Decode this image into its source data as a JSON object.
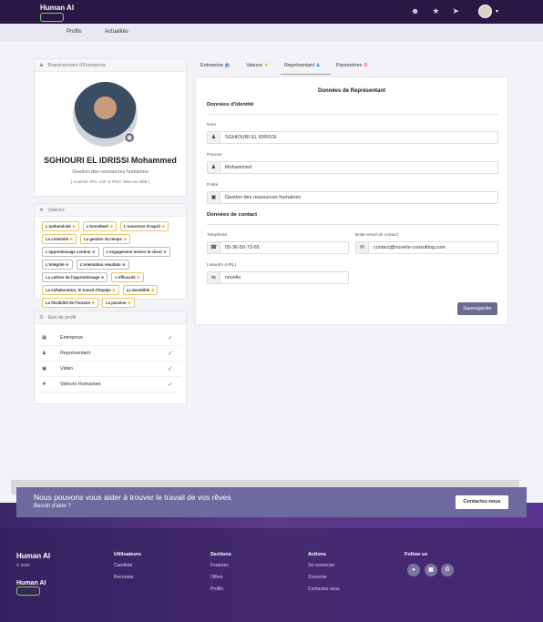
{
  "header": {
    "logo_text": "Human AI",
    "icons": [
      "add-user-icon",
      "star-icon",
      "send-icon"
    ]
  },
  "subnav": {
    "items": [
      "Profils",
      "Actualités"
    ]
  },
  "left_card": {
    "title": "Représentant d'Entreprise",
    "name": "SGHIOURI EL IDRISSI Mohammed",
    "role": "Gestion des ressources humaines",
    "note": "( Autorisé JPG, GIF or PNG. Max est 3MB )"
  },
  "values_card": {
    "title": "Valeurs",
    "tags": [
      {
        "label": "L'authenticité",
        "style": "gold"
      },
      {
        "label": "L'honnêteté",
        "style": "gold"
      },
      {
        "label": "L'ouverture d'esprit",
        "style": "gold"
      },
      {
        "label": "La créativité",
        "style": "gold"
      },
      {
        "label": "La gestion du temps",
        "style": "gold"
      },
      {
        "label": "L'apprentissage continu",
        "style": "grey"
      },
      {
        "label": "L'engagement envers le client",
        "style": "grey"
      },
      {
        "label": "L'intégrité",
        "style": "grey"
      },
      {
        "label": "L'orientation résultats",
        "style": "grey"
      },
      {
        "label": "La culture de l'apprentissage",
        "style": "grey"
      },
      {
        "label": "L'efficacité",
        "style": "gold"
      },
      {
        "label": "La collaboration, le travail d'équipe",
        "style": "gold"
      },
      {
        "label": "La durabilité",
        "style": "gold"
      },
      {
        "label": "La flexibilité de l'horaire",
        "style": "gold"
      },
      {
        "label": "La passion",
        "style": "gold"
      }
    ]
  },
  "state_card": {
    "title": "Etat de profil",
    "rows": [
      {
        "icon": "building-icon",
        "label": "Entreprise"
      },
      {
        "icon": "person-icon",
        "label": "Représentant"
      },
      {
        "icon": "video-icon",
        "label": "Vidéo"
      },
      {
        "icon": "star-icon",
        "label": "Valeurs Humaines"
      }
    ]
  },
  "tabs": [
    "Entreprise",
    "Valeurs",
    "Représentant",
    "Paramètres"
  ],
  "form": {
    "title": "Données de Représentant",
    "identity_title": "Données d'identité",
    "nom_label": "Nom",
    "nom_value": "SGHIOURI EL IDRISSI",
    "prenom_label": "Prenom",
    "prenom_value": "Mohammed",
    "poste_label": "Poste",
    "poste_value": "Gestion des ressources humaines",
    "contact_title": "Données de contact",
    "tel_label": "Telephone",
    "tel_value": "05-36-50-73-65",
    "email_label": "Boite email de contact",
    "email_value": "contact@novelis-consulting.com",
    "linkedin_label": "LinkedIn (URL)",
    "linkedin_value": "novelis",
    "save_label": "Sauvegarder"
  },
  "banner": {
    "headline": "Nous pouvons vous aider à trouver le travail de vos rêves.",
    "sub": "Besoin d'aide ?",
    "button": "Contactez-nous"
  },
  "footer": {
    "brand": "Human AI",
    "copyright": "© 2023",
    "logo_text": "Human AI",
    "columns": [
      {
        "title": "Utilisateurs",
        "links": [
          "Candidat",
          "Recruteur"
        ]
      },
      {
        "title": "Sections",
        "links": [
          "Features",
          "Offres",
          "Profils"
        ]
      },
      {
        "title": "Actions",
        "links": [
          "Se connecter",
          "S'inscrire",
          "Contactez nous"
        ]
      }
    ],
    "follow_title": "Follow us",
    "social": [
      "G"
    ]
  }
}
